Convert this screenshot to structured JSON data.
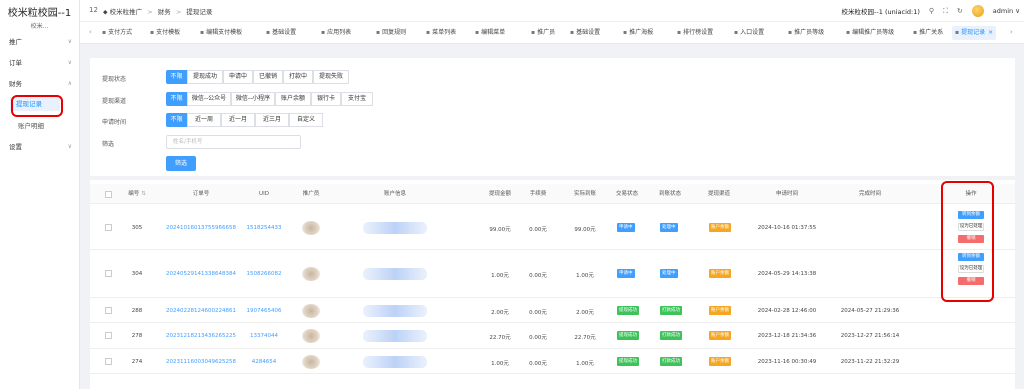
{
  "brand": {
    "title": "校米粒校园--1",
    "subtitle": "校米..."
  },
  "sidebar": {
    "groups": [
      {
        "label": "推广"
      },
      {
        "label": "订单"
      },
      {
        "label": "财务"
      },
      {
        "label": "设置"
      }
    ],
    "finance_items": [
      {
        "label": "提现记录",
        "active": true
      },
      {
        "label": "账户明细",
        "active": false
      }
    ]
  },
  "topbar": {
    "number": "12",
    "breadcrumb": [
      "校米粒推广",
      "财务",
      "提现记录"
    ],
    "school": "校米粒校园--1 (uniacid:1)",
    "user": "admin"
  },
  "tabs": [
    {
      "label": "支付方式",
      "icon": "receipt-icon"
    },
    {
      "label": "支付模板",
      "icon": "receipt-icon"
    },
    {
      "label": "编辑支付模板",
      "icon": "edit-icon"
    },
    {
      "label": "基础设置",
      "icon": "gear-icon"
    },
    {
      "label": "应用列表",
      "icon": "grid-icon"
    },
    {
      "label": "回复规则",
      "icon": "chat-icon"
    },
    {
      "label": "菜单列表",
      "icon": "menu-icon"
    },
    {
      "label": "编辑菜单",
      "icon": "edit-icon"
    },
    {
      "label": "推广员",
      "icon": "user-icon"
    },
    {
      "label": "基础设置",
      "icon": "gear-icon"
    },
    {
      "label": "推广海报",
      "icon": "image-icon"
    },
    {
      "label": "排行榜设置",
      "icon": "chart-icon"
    },
    {
      "label": "入口设置",
      "icon": "door-icon"
    },
    {
      "label": "推广员等级",
      "icon": "user-icon"
    },
    {
      "label": "编辑推广员等级",
      "icon": "edit-icon"
    },
    {
      "label": "推广关系",
      "icon": "link-icon"
    },
    {
      "label": "提现记录",
      "icon": "money-icon",
      "active": true
    }
  ],
  "filters": {
    "status": {
      "label": "提现状态",
      "options": [
        "不限",
        "提现成功",
        "申请中",
        "已撤销",
        "打款中",
        "提现失败"
      ]
    },
    "channel": {
      "label": "提现渠道",
      "options": [
        "不限",
        "微信--公众号",
        "微信--小程序",
        "账户余额",
        "银行卡",
        "支付宝"
      ]
    },
    "time": {
      "label": "申请时间",
      "options": [
        "不限",
        "近一周",
        "近一月",
        "近三月",
        "自定义"
      ]
    },
    "search": {
      "label": "筛选",
      "placeholder": "姓名/手机号",
      "value": ""
    },
    "submit_label": "筛选"
  },
  "table": {
    "headers": [
      "编号",
      "订单号",
      "UID",
      "推广员",
      "账户信息",
      "提现金额",
      "手续费",
      "实际到账",
      "交易状态",
      "到账状态",
      "提现渠道",
      "申请时间",
      "完成时间",
      "操作"
    ],
    "sort_icon": "sort-icon",
    "rows": [
      {
        "id": "305",
        "order": "20241016013755966658",
        "uid": "1518254433",
        "amount": "99.00元",
        "fee": "0.00元",
        "actual": "99.00元",
        "trade_status": "申请中",
        "arrival_status": "处理中",
        "channel": "账户余额",
        "apply_time": "2024-10-16 01:37:55",
        "finish_time": "",
        "actions": [
          "转到余额",
          "设为已处理",
          "撤销"
        ]
      },
      {
        "id": "304",
        "order": "20240529141338648384",
        "uid": "1508266082",
        "amount": "1.00元",
        "fee": "0.00元",
        "actual": "1.00元",
        "trade_status": "申请中",
        "arrival_status": "处理中",
        "channel": "账户余额",
        "apply_time": "2024-05-29 14:13:38",
        "finish_time": "",
        "actions": [
          "转到余额",
          "设为已处理",
          "撤销"
        ]
      },
      {
        "id": "288",
        "order": "20240228124600224861",
        "uid": "1907465406",
        "amount": "2.00元",
        "fee": "0.00元",
        "actual": "2.00元",
        "trade_status": "提现成功",
        "arrival_status": "打款成功",
        "channel": "账户余额",
        "apply_time": "2024-02-28 12:46:00",
        "finish_time": "2024-05-27 21:29:36",
        "actions": []
      },
      {
        "id": "278",
        "order": "20231218213436265225",
        "uid": "13374044",
        "amount": "22.70元",
        "fee": "0.00元",
        "actual": "22.70元",
        "trade_status": "提现成功",
        "arrival_status": "打款成功",
        "channel": "账户余额",
        "apply_time": "2023-12-18 21:34:36",
        "finish_time": "2023-12-27 21:56:14",
        "actions": []
      },
      {
        "id": "274",
        "order": "20231116003049625258",
        "uid": "4284654",
        "amount": "1.00元",
        "fee": "0.00元",
        "actual": "1.00元",
        "trade_status": "提现成功",
        "arrival_status": "打款成功",
        "channel": "账户余额",
        "apply_time": "2023-11-16 00:30:49",
        "finish_time": "2023-11-22 21:32:29",
        "actions": []
      }
    ]
  },
  "colors": {
    "accent": "#409eff",
    "success": "#3ec25a",
    "warning": "#f5a623",
    "danger": "#f56c6c",
    "annotation": "#e60000"
  }
}
